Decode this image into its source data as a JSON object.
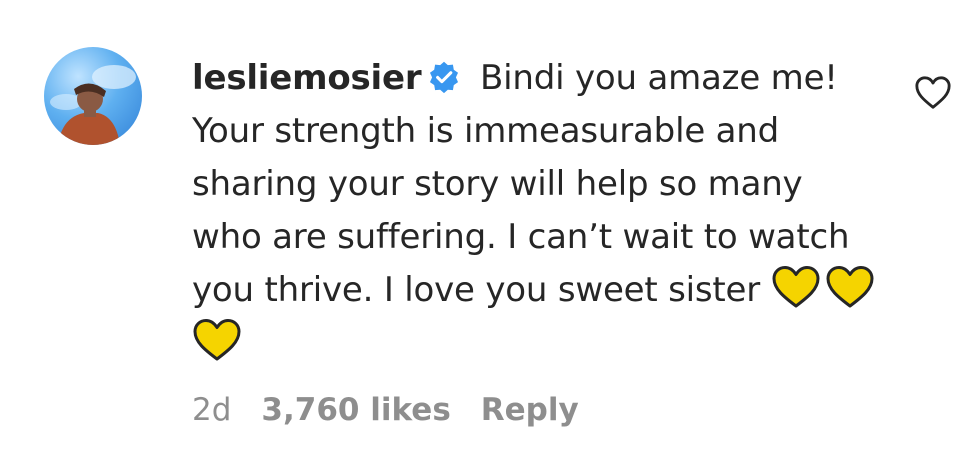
{
  "comment": {
    "username": "lesliemosier",
    "verified": true,
    "text": "Bindi you amaze me! Your strength is immeasurable and sharing your story will help so many who are suffering. I can’t wait to watch you thrive. I love you sweet sister",
    "emojis": [
      "yellow-heart",
      "yellow-heart",
      "yellow-heart"
    ],
    "time_ago": "2d",
    "likes": "3,760 likes",
    "reply_label": "Reply"
  },
  "icons": {
    "like": "heart-outline-icon",
    "verified": "verified-badge-icon"
  },
  "colors": {
    "text": "#262626",
    "muted": "#8e8e8e",
    "verified_blue": "#3897f0",
    "emoji_yellow": "#f5d400"
  }
}
